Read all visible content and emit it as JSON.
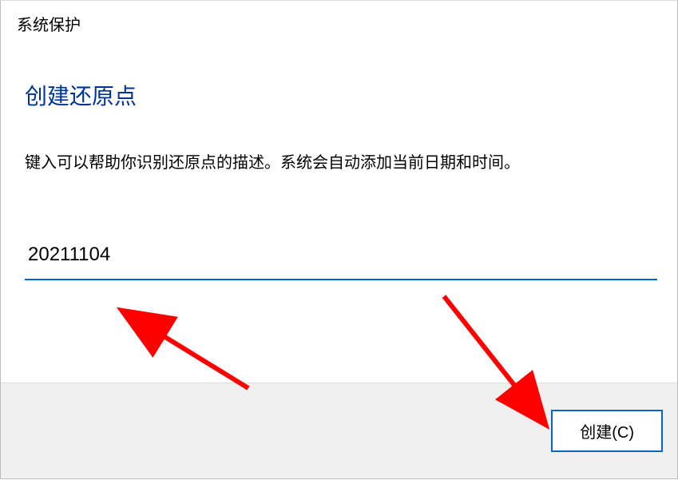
{
  "window": {
    "title": "系统保护"
  },
  "main": {
    "heading": "创建还原点",
    "description": "键入可以帮助你识别还原点的描述。系统会自动添加当前日期和时间。",
    "input_value": "20211104"
  },
  "footer": {
    "create_label": "创建(C)"
  }
}
